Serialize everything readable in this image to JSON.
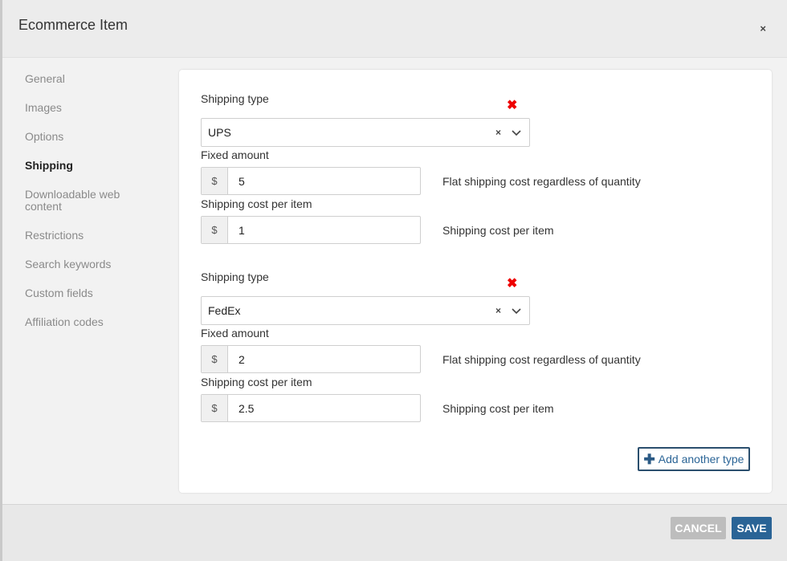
{
  "modal": {
    "title": "Ecommerce Item",
    "close_icon": "×"
  },
  "sidebar": {
    "items": [
      {
        "label": "General"
      },
      {
        "label": "Images"
      },
      {
        "label": "Options"
      },
      {
        "label": "Shipping"
      },
      {
        "label": "Downloadable web content"
      },
      {
        "label": "Restrictions"
      },
      {
        "label": "Search keywords"
      },
      {
        "label": "Custom fields"
      },
      {
        "label": "Affiliation codes"
      }
    ],
    "active": "Shipping"
  },
  "shipping": {
    "types": [
      {
        "type_label": "Shipping type",
        "remove_icon": "✖",
        "selected": "UPS",
        "clear_icon": "×",
        "fixed_label": "Fixed amount",
        "currency": "$",
        "fixed_value": "5",
        "fixed_help": "Flat shipping cost regardless of quantity",
        "per_item_label": "Shipping cost per item",
        "per_item_value": "1",
        "per_item_help": "Shipping cost per item"
      },
      {
        "type_label": "Shipping type",
        "remove_icon": "✖",
        "selected": "FedEx",
        "clear_icon": "×",
        "fixed_label": "Fixed amount",
        "currency": "$",
        "fixed_value": "2",
        "fixed_help": "Flat shipping cost regardless of quantity",
        "per_item_label": "Shipping cost per item",
        "per_item_value": "2.5",
        "per_item_help": "Shipping cost per item"
      }
    ],
    "add_button": "Add another type"
  },
  "footer": {
    "cancel": "CANCEL",
    "save": "SAVE"
  },
  "colors": {
    "primary": "#2a6496",
    "remove": "#e00000",
    "cancel": "#bdbdbd"
  }
}
